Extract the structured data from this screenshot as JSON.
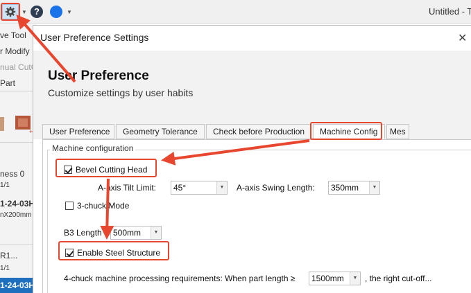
{
  "toolbar": {
    "gear_icon": "gear-icon",
    "help_icon": "help-icon",
    "help_glyph": "?",
    "color_icon": "color-circle-icon",
    "window_title": "Untitled - T"
  },
  "left_panel": {
    "items": [
      "ve Tool",
      "r Modify",
      "nual CutO",
      "Part"
    ],
    "rows": [
      "ness 0",
      "1/1",
      "1-24-03H",
      "nX200mm",
      "R1...",
      "1/1",
      "1-24-03H"
    ]
  },
  "dialog": {
    "title": "User Preference Settings",
    "close_glyph": "✕",
    "header_title": "User Preference",
    "header_subtitle": "Customize settings by user habits",
    "tabs": [
      "User Preference",
      "Geometry Tolerance",
      "Check before Production",
      "Machine Config",
      "Mes"
    ],
    "active_tab": "Machine Config",
    "group_label": "Machine configuration",
    "bevel_cutting_head": {
      "label": "Bevel Cutting Head",
      "checked": true
    },
    "a_axis_tilt_limit": {
      "label": "A-axis Tilt Limit:",
      "value": "45°"
    },
    "a_axis_swing_length": {
      "label": "A-axis Swing Length:",
      "value": "350mm"
    },
    "three_chuck_mode": {
      "label": "3-chuck Mode",
      "checked": false
    },
    "b3_length": {
      "label": "B3 Length",
      "value": "500mm"
    },
    "enable_steel_structure": {
      "label": "Enable Steel Structure",
      "checked": true
    },
    "four_chuck": {
      "label": "4-chuck machine processing requirements: When part length ≥",
      "value": "1500mm",
      "suffix": ", the right cut-off..."
    }
  },
  "annotation_color": "#e8472f"
}
